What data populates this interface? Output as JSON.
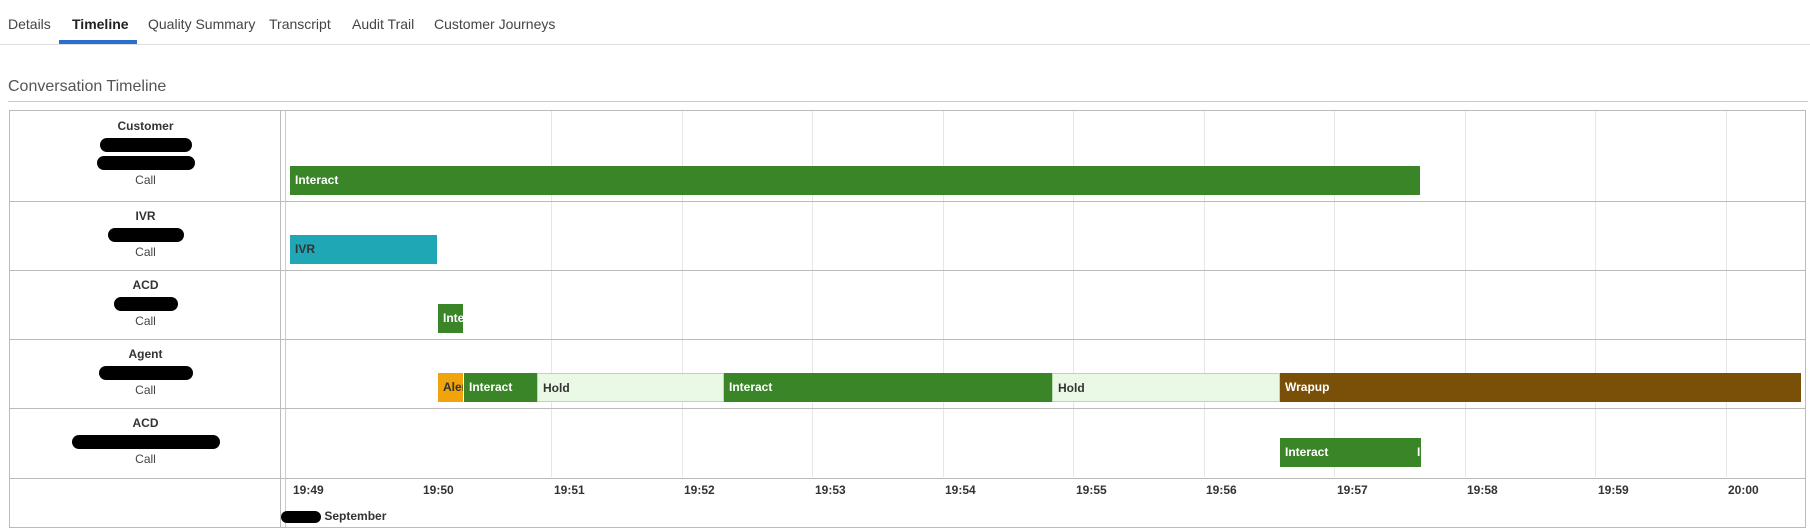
{
  "tabs": [
    {
      "label": "Details",
      "active": false
    },
    {
      "label": "Timeline",
      "active": true
    },
    {
      "label": "Quality Summary",
      "active": false
    },
    {
      "label": "Transcript",
      "active": false
    },
    {
      "label": "Audit Trail",
      "active": false
    },
    {
      "label": "Customer Journeys",
      "active": false
    }
  ],
  "section_title": "Conversation Timeline",
  "rows": [
    {
      "title": "Customer",
      "media": "Call"
    },
    {
      "title": "IVR",
      "media": "Call"
    },
    {
      "title": "ACD",
      "media": "Call"
    },
    {
      "title": "Agent",
      "media": "Call"
    },
    {
      "title": "ACD",
      "media": "Call"
    }
  ],
  "segments": [
    {
      "label": "Interact",
      "type": "interact"
    },
    {
      "label": "IVR",
      "type": "ivr"
    },
    {
      "label": "Interact",
      "type": "interact"
    },
    {
      "label": "Alert",
      "type": "alert"
    },
    {
      "label": "Interact",
      "type": "interact"
    },
    {
      "label": "Hold",
      "type": "hold"
    },
    {
      "label": "Interact",
      "type": "interact"
    },
    {
      "label": "Hold",
      "type": "hold"
    },
    {
      "label": "Wrapup",
      "type": "wrapup"
    },
    {
      "label": "Interact",
      "type": "interact"
    },
    {
      "label": "Interact",
      "type": "interact"
    }
  ],
  "ticks": [
    "19:49",
    "19:50",
    "19:51",
    "19:52",
    "19:53",
    "19:54",
    "19:55",
    "19:56",
    "19:57",
    "19:58",
    "19:59",
    "20:00"
  ],
  "date_label": "September",
  "colors": {
    "interact": "#3a8527",
    "ivr": "#1fa7b5",
    "alert": "#f0a30a",
    "hold": "#eaf8e6",
    "wrapup": "#7a4f08",
    "tab_underline": "#2a6fc9"
  }
}
